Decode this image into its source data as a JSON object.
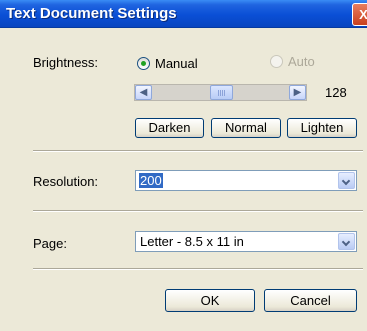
{
  "window": {
    "title": "Text Document Settings",
    "close_glyph": "X"
  },
  "brightness": {
    "label": "Brightness:",
    "manual_label": "Manual",
    "auto_label": "Auto",
    "selected": "Manual",
    "value": "128",
    "darken_label": "Darken",
    "normal_label": "Normal",
    "lighten_label": "Lighten"
  },
  "resolution": {
    "label": "Resolution:",
    "value": "200"
  },
  "page": {
    "label": "Page:",
    "value": "Letter - 8.5 x 11 in"
  },
  "footer": {
    "ok_label": "OK",
    "cancel_label": "Cancel"
  },
  "colors": {
    "titlebar": "#0a4fd6",
    "radio_dot": "#21a121",
    "selection": "#316ac5"
  }
}
